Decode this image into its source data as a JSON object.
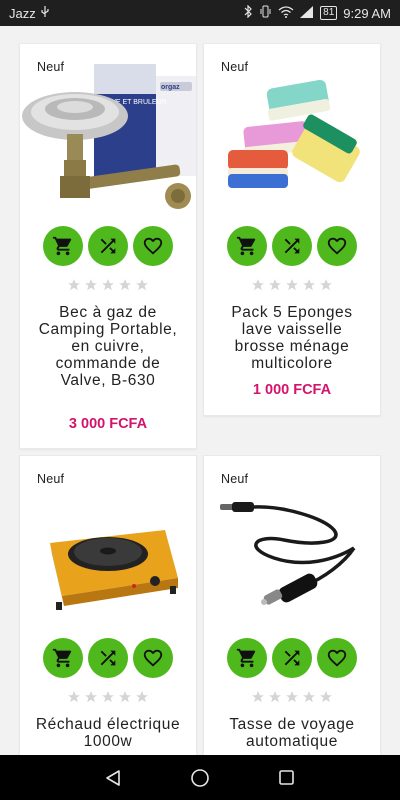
{
  "status_bar": {
    "carrier": "Jazz",
    "battery": "81",
    "time": "9:29 AM"
  },
  "colors": {
    "accent": "#4fb81c",
    "price": "#d4136d"
  },
  "products": [
    {
      "badge": "Neuf",
      "title": "Bec à gaz de Camping Portable, en cuivre, commande de Valve, B-630",
      "price": "3 000 FCFA",
      "image_icon": "gas-burner-image",
      "package_text": "VALVE ET BRULEUR",
      "brand": "orgaz"
    },
    {
      "badge": "Neuf",
      "title": "Pack 5 Eponges lave vaisselle brosse ménage multicolore",
      "price": "1 000 FCFA",
      "image_icon": "sponges-image"
    },
    {
      "badge": "Neuf",
      "title": "Réchaud électrique 1000w",
      "price": "",
      "image_icon": "electric-hotplate-image"
    },
    {
      "badge": "Neuf",
      "title": "Tasse de voyage automatique",
      "price": "",
      "image_icon": "car-charger-cable-image"
    }
  ],
  "actions": {
    "cart_icon": "cart-icon",
    "compare_icon": "shuffle-icon",
    "wishlist_icon": "heart-icon"
  },
  "rating": {
    "stars": 0,
    "max": 5
  },
  "nav": {
    "back_icon": "back-icon",
    "home_icon": "home-icon",
    "recents_icon": "recents-icon"
  }
}
